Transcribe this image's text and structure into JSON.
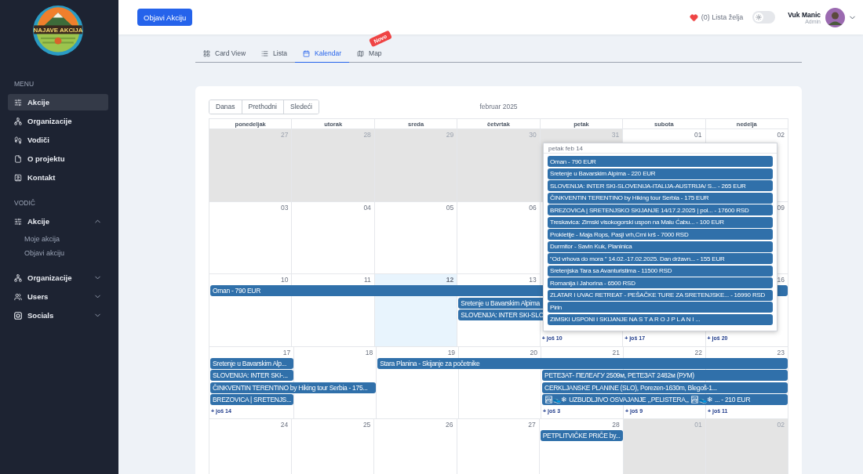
{
  "logo": {
    "text": "NAJAVE AKCIJA"
  },
  "sidebar": {
    "sections": [
      {
        "title": "MENU",
        "items": [
          {
            "label": "Akcije",
            "selected": true
          },
          {
            "label": "Organizacije",
            "selected": false
          },
          {
            "label": "Vodiči",
            "selected": false
          },
          {
            "label": "O projektu",
            "selected": false
          },
          {
            "label": "Kontakt",
            "selected": false
          }
        ]
      },
      {
        "title": "VODIČ",
        "items": [
          {
            "label": "Akcije",
            "selected": false,
            "expanded": true,
            "children": [
              {
                "label": "Moje akcija"
              },
              {
                "label": "Objavi akciju"
              }
            ]
          },
          {
            "label": "Organizacije",
            "selected": false,
            "expanded": false
          },
          {
            "label": "Users",
            "selected": false,
            "expanded": false
          },
          {
            "label": "Socials",
            "selected": false,
            "expanded": false
          }
        ]
      }
    ]
  },
  "header": {
    "publish_button": "Objavi Akciju",
    "wishlist": "(0) Lista želja",
    "theme_toggle": {
      "on": false
    },
    "user": {
      "name": "Vuk Manic",
      "role": "Admin"
    }
  },
  "tabs": [
    {
      "label": "Card View",
      "selected": false
    },
    {
      "label": "Lista",
      "selected": false
    },
    {
      "label": "Kalendar",
      "selected": true
    },
    {
      "label": "Map",
      "selected": false,
      "badge": "Novo"
    }
  ],
  "calendar": {
    "buttons": [
      "Danas",
      "Prethodni",
      "Sledeći"
    ],
    "title": "februar 2025",
    "weekdays": [
      "ponedeljak",
      "utorak",
      "sreda",
      "četvrtak",
      "petak",
      "subota",
      "nedelja"
    ],
    "weeks": [
      {
        "days": [
          {
            "number": "27",
            "muted": true,
            "today": false
          },
          {
            "number": "28",
            "muted": true,
            "today": false
          },
          {
            "number": "29",
            "muted": true,
            "today": false
          },
          {
            "number": "30",
            "muted": true,
            "today": false
          },
          {
            "number": "31",
            "muted": true,
            "today": false
          },
          {
            "number": "01",
            "muted": false,
            "today": false
          },
          {
            "number": "02",
            "muted": false,
            "today": false
          }
        ]
      },
      {
        "days": [
          {
            "number": "03",
            "muted": false,
            "today": false
          },
          {
            "number": "04",
            "muted": false,
            "today": false
          },
          {
            "number": "05",
            "muted": false,
            "today": false
          },
          {
            "number": "06",
            "muted": false,
            "today": false
          }
        ],
        "trailing_days": [
          {
            "number": "09",
            "muted": false,
            "today": false
          }
        ]
      },
      {
        "days": [
          {
            "number": "10",
            "muted": false,
            "today": false,
            "events": [
              {
                "kind": "start",
                "title": "Oman - 790 EUR"
              }
            ]
          },
          {
            "number": "11",
            "muted": false,
            "today": false,
            "events": [
              {
                "kind": "continue"
              }
            ]
          },
          {
            "number": "12",
            "muted": false,
            "today": true,
            "events": [
              {
                "kind": "continue"
              }
            ]
          },
          {
            "number": "13",
            "muted": false,
            "today": false,
            "events": [
              {
                "kind": "continue"
              },
              {
                "kind": "start",
                "title": "Sretenje u Bavarskim Alpima"
              },
              {
                "kind": "start",
                "title": "SLOVENIJA: INTER SKI-SLO"
              }
            ]
          },
          {
            "events": [
              {
                "kind": "continue"
              },
              {
                "kind": "continue"
              },
              {
                "kind": "continue"
              }
            ],
            "more": "+ još 10"
          },
          {
            "events": [
              {
                "kind": "continue"
              }
            ],
            "more": "+ još 17"
          },
          {
            "number": "16",
            "muted": false,
            "today": false,
            "events": [
              {
                "kind": "continue"
              }
            ],
            "more": "+ još 20"
          }
        ]
      },
      {
        "days": [
          {
            "number": "17",
            "muted": false,
            "today": false,
            "events": [
              {
                "kind": "start",
                "title": "Sretenje u Bavarskim Alp..."
              },
              {
                "kind": "start",
                "title": "SLOVENIJA: INTER SKI-..."
              },
              {
                "kind": "start",
                "title": "ČINKVENTIN TERENTINO by Hiking tour Serbia - 175..."
              },
              {
                "kind": "start",
                "title": "BREZOVICA | SRETENJS..."
              }
            ],
            "more": "+ još 14"
          },
          {
            "number": "18",
            "muted": false,
            "today": false,
            "events": [
              {
                "kind": "empty"
              },
              {
                "kind": "empty"
              },
              {
                "kind": "continue"
              }
            ]
          },
          {
            "number": "19",
            "muted": false,
            "today": false,
            "events": [
              {
                "kind": "start",
                "title": "Stara Planina - Skijanje za početnike"
              }
            ]
          },
          {
            "number": "20",
            "muted": false,
            "today": false,
            "events": [
              {
                "kind": "continue"
              }
            ]
          },
          {
            "number": "21",
            "muted": false,
            "today": false,
            "events": [
              {
                "kind": "continue"
              },
              {
                "kind": "start",
                "title": "РЕТЕЗАТ- ПЕЛЕАГУ 2509м, РЕТЕЗАТ 2482м (РУМ)"
              },
              {
                "kind": "start",
                "title": "CERKLJANSKE PLANINE (SLO), Porezen-1630m, Blegoš-1..."
              },
              {
                "kind": "start",
                "title": "🏞👟❄ UZBUDLJIVO OSVAJANJE ,,PELISTERA,, 🏞👟❄ ... - 210 EUR"
              }
            ],
            "more": "+ još 3"
          },
          {
            "number": "22",
            "muted": false,
            "today": false,
            "events": [
              {
                "kind": "continue"
              },
              {
                "kind": "continue"
              },
              {
                "kind": "continue"
              },
              {
                "kind": "continue"
              }
            ],
            "more": "+ još 9"
          },
          {
            "number": "23",
            "muted": false,
            "today": false,
            "events": [
              {
                "kind": "continue"
              },
              {
                "kind": "continue"
              },
              {
                "kind": "continue"
              },
              {
                "kind": "continue"
              }
            ],
            "more": "+ još 11"
          }
        ]
      },
      {
        "days": [
          {
            "number": "24",
            "muted": false,
            "today": false
          },
          {
            "number": "25",
            "muted": false,
            "today": false
          },
          {
            "number": "26",
            "muted": false,
            "today": false
          },
          {
            "number": "27",
            "muted": false,
            "today": false
          },
          {
            "number": "28",
            "muted": false,
            "today": false,
            "events": [
              {
                "kind": "start",
                "title": "PETPLITVIČKE PRIČE by..."
              }
            ]
          },
          {
            "number": "01",
            "muted": true,
            "today": false
          },
          {
            "number": "02",
            "muted": true,
            "today": false
          }
        ]
      }
    ],
    "popover": {
      "title": "petak feb 14",
      "events": [
        "Oman - 790 EUR",
        "Sretenje u Bavarskim Alpima - 220 EUR",
        "SLOVENIJA: INTER SKI-SLOVENIJA-ITALIJA-AUSTRIJA/ S... - 265 EUR",
        "ČINKVENTIN TERENTINO by Hiking tour Serbia - 175 EUR",
        "BREZOVICA | SRETENJSKO SKIJANJE 14/17.2.2025 | pol... - 17600 RSD",
        "Treskavica: Zimski visokogorski uspon na Malu Ćabu... - 100 EUR",
        "Prokletije - Maja Rops, Pasji vrh,Crni krš - 7000 RSD",
        "Durmitor - Savin Kuk, Planinica",
        "\"Od vrhova do mora \" 14.02.-17.02.2025. Dan državn... - 155 EUR",
        "Sretenjska Tara sa Avanturistima - 11500 RSD",
        "Romanija i Jahorina - 6500 RSD",
        "ZLATAR I UVAC RETREAT - PEŠAČKE TURE ZA SRETENJSKE... - 16990 RSD",
        "Pirin",
        "ZIMSKI USPONI I SKIJANJE NA S T A R O J P L A N I ..."
      ]
    }
  }
}
